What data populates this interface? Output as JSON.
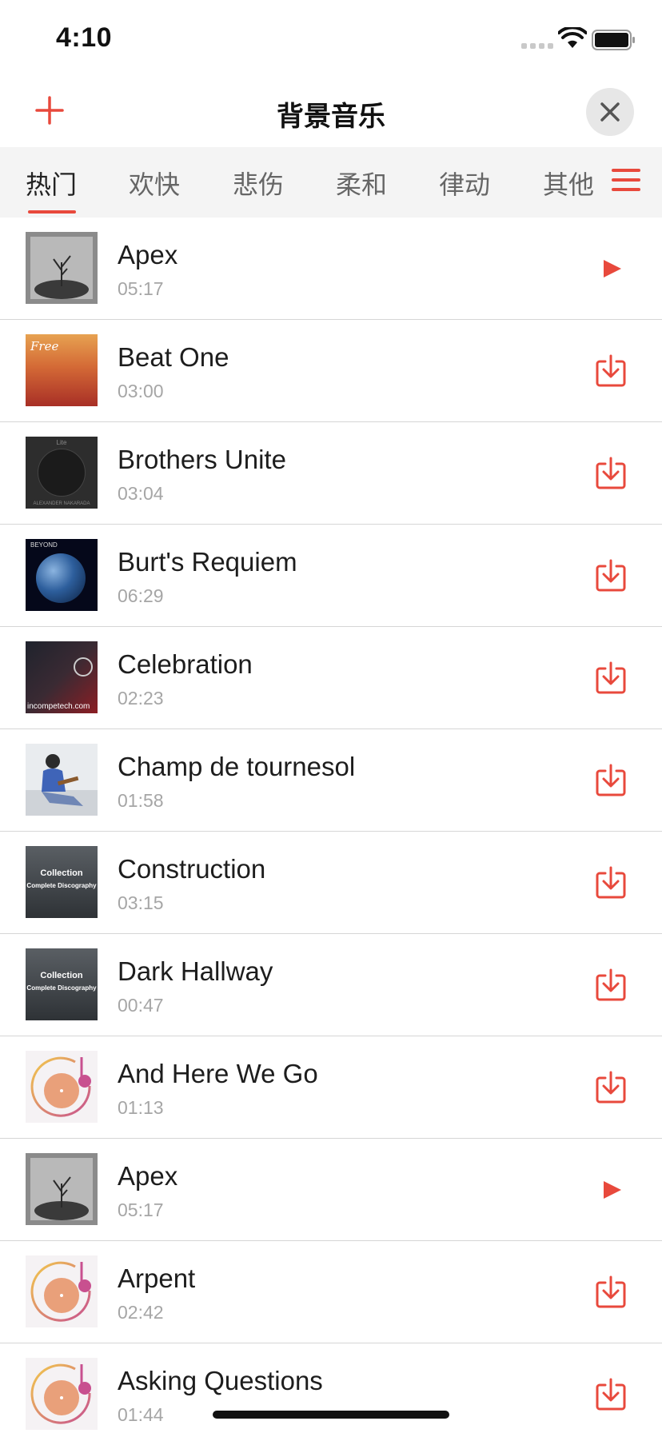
{
  "status_bar": {
    "time": "4:10"
  },
  "header": {
    "title": "背景音乐"
  },
  "tabs": [
    {
      "label": "热门",
      "active": true
    },
    {
      "label": "欢快",
      "active": false
    },
    {
      "label": "悲伤",
      "active": false
    },
    {
      "label": "柔和",
      "active": false
    },
    {
      "label": "律动",
      "active": false
    },
    {
      "label": "其他",
      "active": false
    }
  ],
  "songs": [
    {
      "title": "Apex",
      "duration": "05:17",
      "cover": "tree-cover",
      "action": "play-icon"
    },
    {
      "title": "Beat One",
      "duration": "03:00",
      "cover": "sunset-cover",
      "action": "download-icon"
    },
    {
      "title": "Brothers Unite",
      "duration": "03:04",
      "cover": "dark-circle-cover",
      "action": "download-icon"
    },
    {
      "title": "Burt's Requiem",
      "duration": "06:29",
      "cover": "earth-cover",
      "action": "download-icon"
    },
    {
      "title": "Celebration",
      "duration": "02:23",
      "cover": "dark-red-cover",
      "action": "download-icon"
    },
    {
      "title": "Champ de tournesol",
      "duration": "01:58",
      "cover": "photo-cover",
      "action": "download-icon"
    },
    {
      "title": "Construction",
      "duration": "03:15",
      "cover": "collection-cover",
      "action": "download-icon"
    },
    {
      "title": "Dark Hallway",
      "duration": "00:47",
      "cover": "collection-cover",
      "action": "download-icon"
    },
    {
      "title": "And Here We Go",
      "duration": "01:13",
      "cover": "music-note-cover",
      "action": "download-icon"
    },
    {
      "title": "Apex",
      "duration": "05:17",
      "cover": "tree-cover",
      "action": "play-icon"
    },
    {
      "title": "Arpent",
      "duration": "02:42",
      "cover": "music-note-cover",
      "action": "download-icon"
    },
    {
      "title": "Asking Questions",
      "duration": "01:44",
      "cover": "music-note-cover",
      "action": "download-icon"
    }
  ],
  "cover_text": {
    "beat_one": "Free",
    "brothers_top": "Lite",
    "brothers_bottom": "ALEXANDER NAKARADA",
    "earth_top": "BEYOND",
    "celebration_url": "incompetech.com",
    "collection_title": "Collection",
    "collection_subtitle": "Complete Discography"
  },
  "colors": {
    "accent": "#e8493c",
    "tab_bg": "#f4f4f4",
    "divider": "#d6d6d6",
    "duration": "#a6a6a6"
  }
}
